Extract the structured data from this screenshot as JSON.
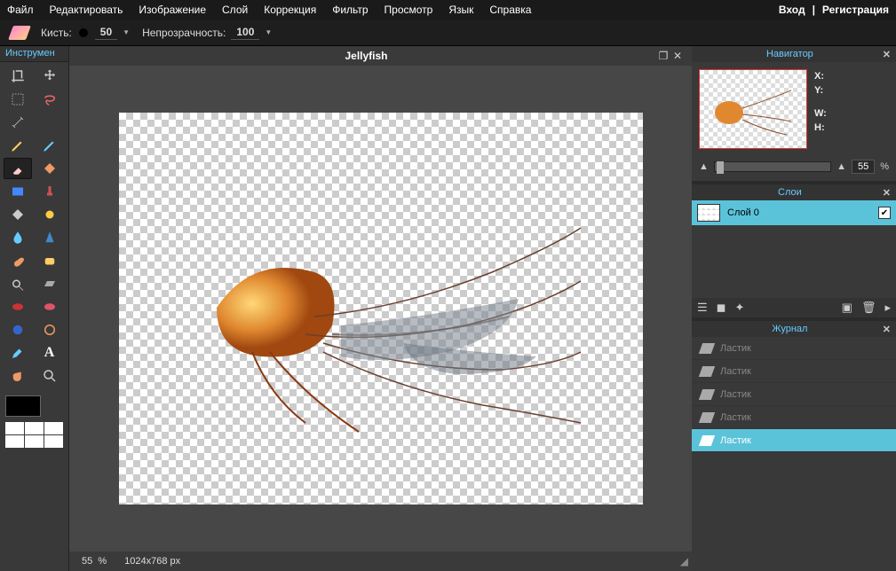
{
  "menu": {
    "items": [
      "Файл",
      "Редактировать",
      "Изображение",
      "Слой",
      "Коррекция",
      "Фильтр",
      "Просмотр",
      "Язык",
      "Справка"
    ],
    "login": "Вход",
    "sep": "|",
    "register": "Регистрация"
  },
  "options": {
    "brush_label": "Кисть:",
    "brush_size": "50",
    "opacity_label": "Непрозрачность:",
    "opacity_value": "100"
  },
  "tools": {
    "title": "Инструмен"
  },
  "document": {
    "title": "Jellyfish",
    "zoom": "55",
    "zoom_pct": "%",
    "dimensions": "1024x768 px"
  },
  "navigator": {
    "title": "Навигатор",
    "x_label": "X:",
    "y_label": "Y:",
    "w_label": "W:",
    "h_label": "H:",
    "zoom_value": "55",
    "pct": "%"
  },
  "layers": {
    "title": "Слои",
    "items": [
      {
        "name": "Слой 0",
        "visible": true
      }
    ]
  },
  "history": {
    "title": "Журнал",
    "items": [
      {
        "name": "Ластик",
        "active": false
      },
      {
        "name": "Ластик",
        "active": false
      },
      {
        "name": "Ластик",
        "active": false
      },
      {
        "name": "Ластик",
        "active": false
      },
      {
        "name": "Ластик",
        "active": true
      }
    ]
  }
}
